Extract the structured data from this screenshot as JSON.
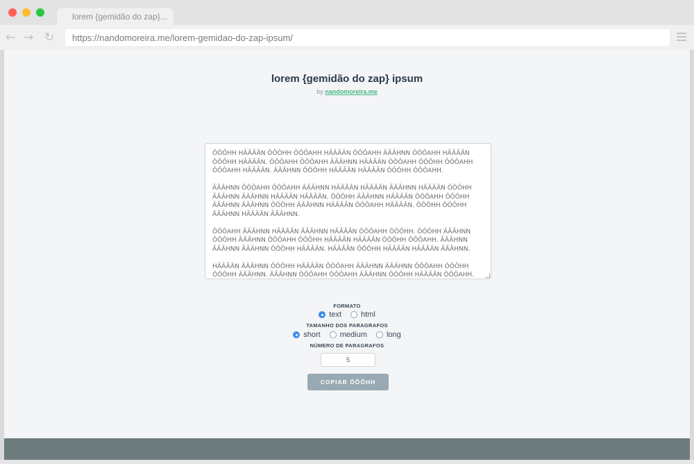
{
  "browser": {
    "tab_title": "lorem {gemidão do zap}...",
    "url": "https://nandomoreira.me/lorem-gemidao-do-zap-ipsum/",
    "back_icon": "←",
    "forward_icon": "→",
    "reload_icon": "↻"
  },
  "header": {
    "title": "lorem {gemidão do zap} ipsum",
    "by": "by",
    "author_link": "nandomoreira.me"
  },
  "output": {
    "paragraphs": [
      "ÔÔÔHH HÃÃÃÃN ÔÔÔHH ÔÔÔAHH HÃÃÃÃN ÔÔÔAHH ÃÃÃHNN ÔÔÔAHH HÃÃÃÃN ÔÔÔHH HÃÃÃÃN. ÔÔÔAHH ÔÔÔAHH ÃÃÃHNN HÃÃÃÃN ÔÔÔAHH ÔÔÔHH ÔÔÔAHH ÔÔÔAHH HÃÃÃÃN. ÃÃÃHNN ÔÔÔHH HÃÃÃÃN HÃÃÃÃN ÔÔÔHH ÔÔÔAHH.",
      "ÃÃÃHNN ÔÔÔAHH ÔÔÔAHH ÃÃÃHNN HÃÃÃÃN HÃÃÃÃN ÃÃÃHNN HÃÃÃÃN ÔÔÔHH ÃÃÃHNN ÃÃÃHNN HÃÃÃÃN HÃÃÃÃN. ÔÔÔHH ÃÃÃHNN HÃÃÃÃN ÔÔÔAHH ÔÔÔHH ÃÃÃHNN ÃÃÃHNN ÔÔÔHH ÃÃÃHNN HÃÃÃÃN ÔÔÔAHH HÃÃÃÃN. ÔÔÔHH ÔÔÔHH ÃÃÃHNN HÃÃÃÃN ÃÃÃHNN.",
      "ÔÔÔAHH ÃÃÃHNN HÃÃÃÃN ÃÃÃHNN HÃÃÃÃN ÔÔÔAHH ÔÔÔHH. ÔÔÔHH ÃÃÃHNN ÔÔÔHH ÃÃÃHNN ÔÔÔAHH ÔÔÔHH HÃÃÃÃN HÃÃÃÃN ÔÔÔHH ÔÔÔAHH. ÃÃÃHNN ÃÃÃHNN ÃÃÃHNN ÔÔÔHH HÃÃÃÃN. HÃÃÃÃN ÔÔÔHH HÃÃÃÃN HÃÃÃÃN ÃÃÃHNN.",
      "HÃÃÃÃN ÃÃÃHNN ÔÔÔHH HÃÃÃÃN ÔÔÔAHH ÃÃÃHNN ÃÃÃHNN ÔÔÔAHH ÔÔÔHH ÔÔÔHH ÃÃÃHNN. ÃÃÃHNN ÔÔÔAHH ÔÔÔAHH ÃÃÃHNN ÔÔÔHH HÃÃÃÃN ÔÔÔAHH."
    ]
  },
  "options": {
    "formato_label": "FORMATO",
    "formato": [
      {
        "label": "text",
        "checked": true
      },
      {
        "label": "html",
        "checked": false
      }
    ],
    "tamanho_label": "TAMANHO DOS PARAGRAFOS",
    "tamanho": [
      {
        "label": "short",
        "checked": true
      },
      {
        "label": "medium",
        "checked": false
      },
      {
        "label": "long",
        "checked": false
      }
    ],
    "numero_label": "NÚMERO DE PARAGRAFOS",
    "numero_value": "5",
    "copy_button": "COPIAR ÔÔÔHH"
  },
  "colors": {
    "accent": "#3b8ee8",
    "link": "#41b883",
    "button": "#98a9b3",
    "footer": "#6e7b7d"
  }
}
